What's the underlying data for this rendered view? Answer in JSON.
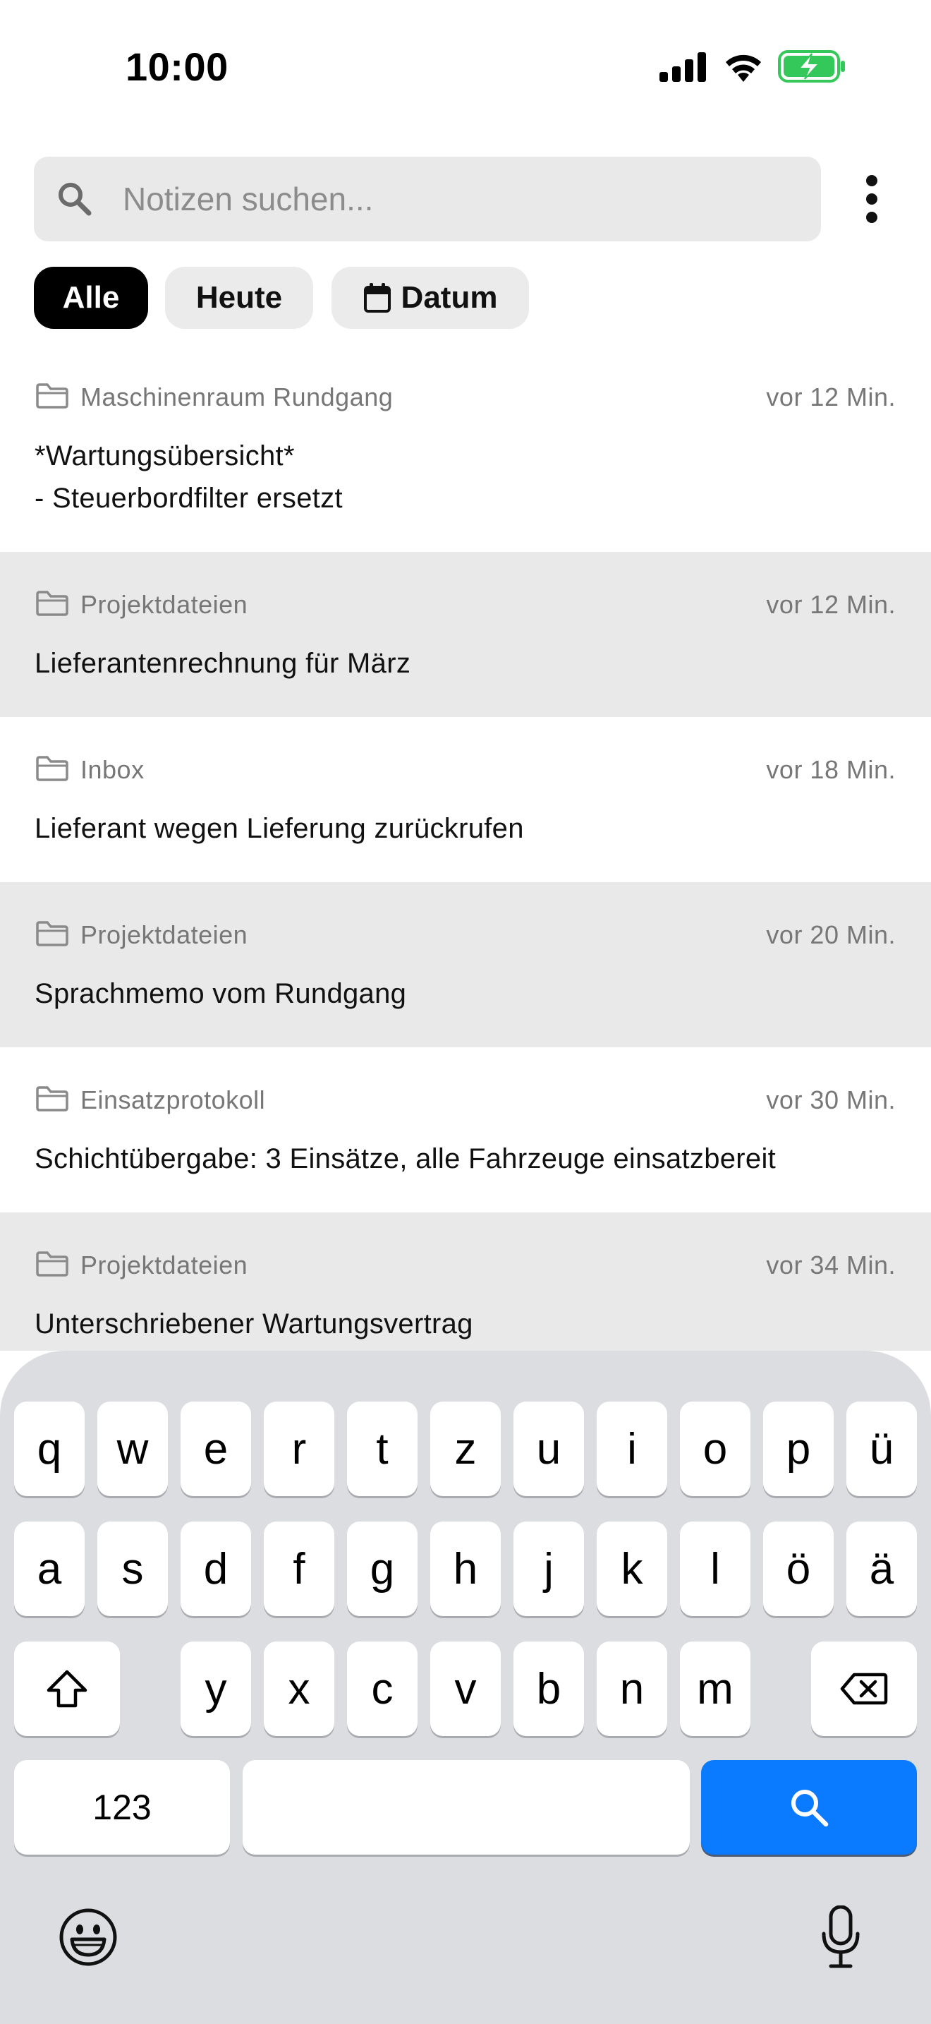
{
  "status_bar": {
    "time": "10:00"
  },
  "search": {
    "placeholder": "Notizen suchen..."
  },
  "filters": [
    {
      "label": "Alle",
      "active": true
    },
    {
      "label": "Heute",
      "active": false
    },
    {
      "label": "Datum",
      "active": false,
      "icon": "calendar-icon"
    }
  ],
  "notes": [
    {
      "folder": "Maschinenraum Rundgang",
      "time": "vor 12 Min.",
      "text": "*Wartungsübersicht*\n- Steuerbordfilter ersetzt"
    },
    {
      "folder": "Projektdateien",
      "time": "vor 12 Min.",
      "text": "Lieferantenrechnung für März"
    },
    {
      "folder": "Inbox",
      "time": "vor 18 Min.",
      "text": "Lieferant wegen Lieferung zurückrufen"
    },
    {
      "folder": "Projektdateien",
      "time": "vor 20 Min.",
      "text": "Sprachmemo vom Rundgang"
    },
    {
      "folder": "Einsatzprotokoll",
      "time": "vor 30 Min.",
      "text": "Schichtübergabe: 3 Einsätze, alle Fahrzeuge einsatzbereit"
    },
    {
      "folder": "Projektdateien",
      "time": "vor 34 Min.",
      "text": "Unterschriebener Wartungsvertrag"
    }
  ],
  "keyboard": {
    "row1": [
      "q",
      "w",
      "e",
      "r",
      "t",
      "z",
      "u",
      "i",
      "o",
      "p",
      "ü"
    ],
    "row2": [
      "a",
      "s",
      "d",
      "f",
      "g",
      "h",
      "j",
      "k",
      "l",
      "ö",
      "ä"
    ],
    "row3": [
      "y",
      "x",
      "c",
      "v",
      "b",
      "n",
      "m"
    ],
    "numbers_label": "123",
    "accent_color": "#0a7aff"
  }
}
